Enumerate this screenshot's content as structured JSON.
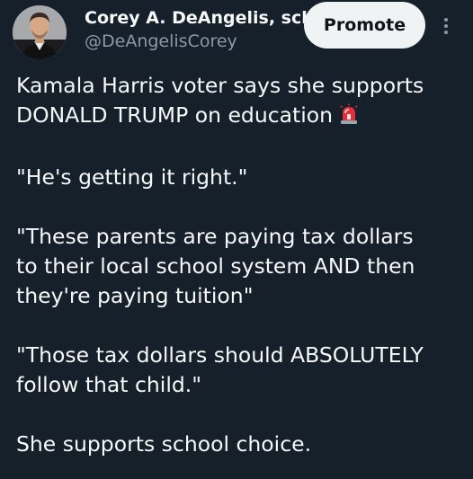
{
  "author": {
    "display_name": "Corey A. DeAngelis, school choice evangelist",
    "handle": "@DeAngelisCorey",
    "avatar_icon": "profile-photo"
  },
  "actions": {
    "promote_label": "Promote",
    "more_icon": "more-options-icon"
  },
  "tweet": {
    "paragraph_1": "Kamala Harris voter says she supports\nDONALD TRUMP on education",
    "emoji": "siren-emoji",
    "paragraph_2": "\"He's getting it right.\"",
    "paragraph_3": "\"These parents are paying tax dollars\nto their local school system AND then\nthey're paying tuition\"",
    "paragraph_4": "\"Those tax dollars should ABSOLUTELY\nfollow that child.\"",
    "paragraph_5": "She supports school choice."
  },
  "colors": {
    "background": "#15202b",
    "text_primary": "#f7f9f9",
    "text_secondary": "#8b98a5",
    "promote_bg": "#eff3f4"
  }
}
